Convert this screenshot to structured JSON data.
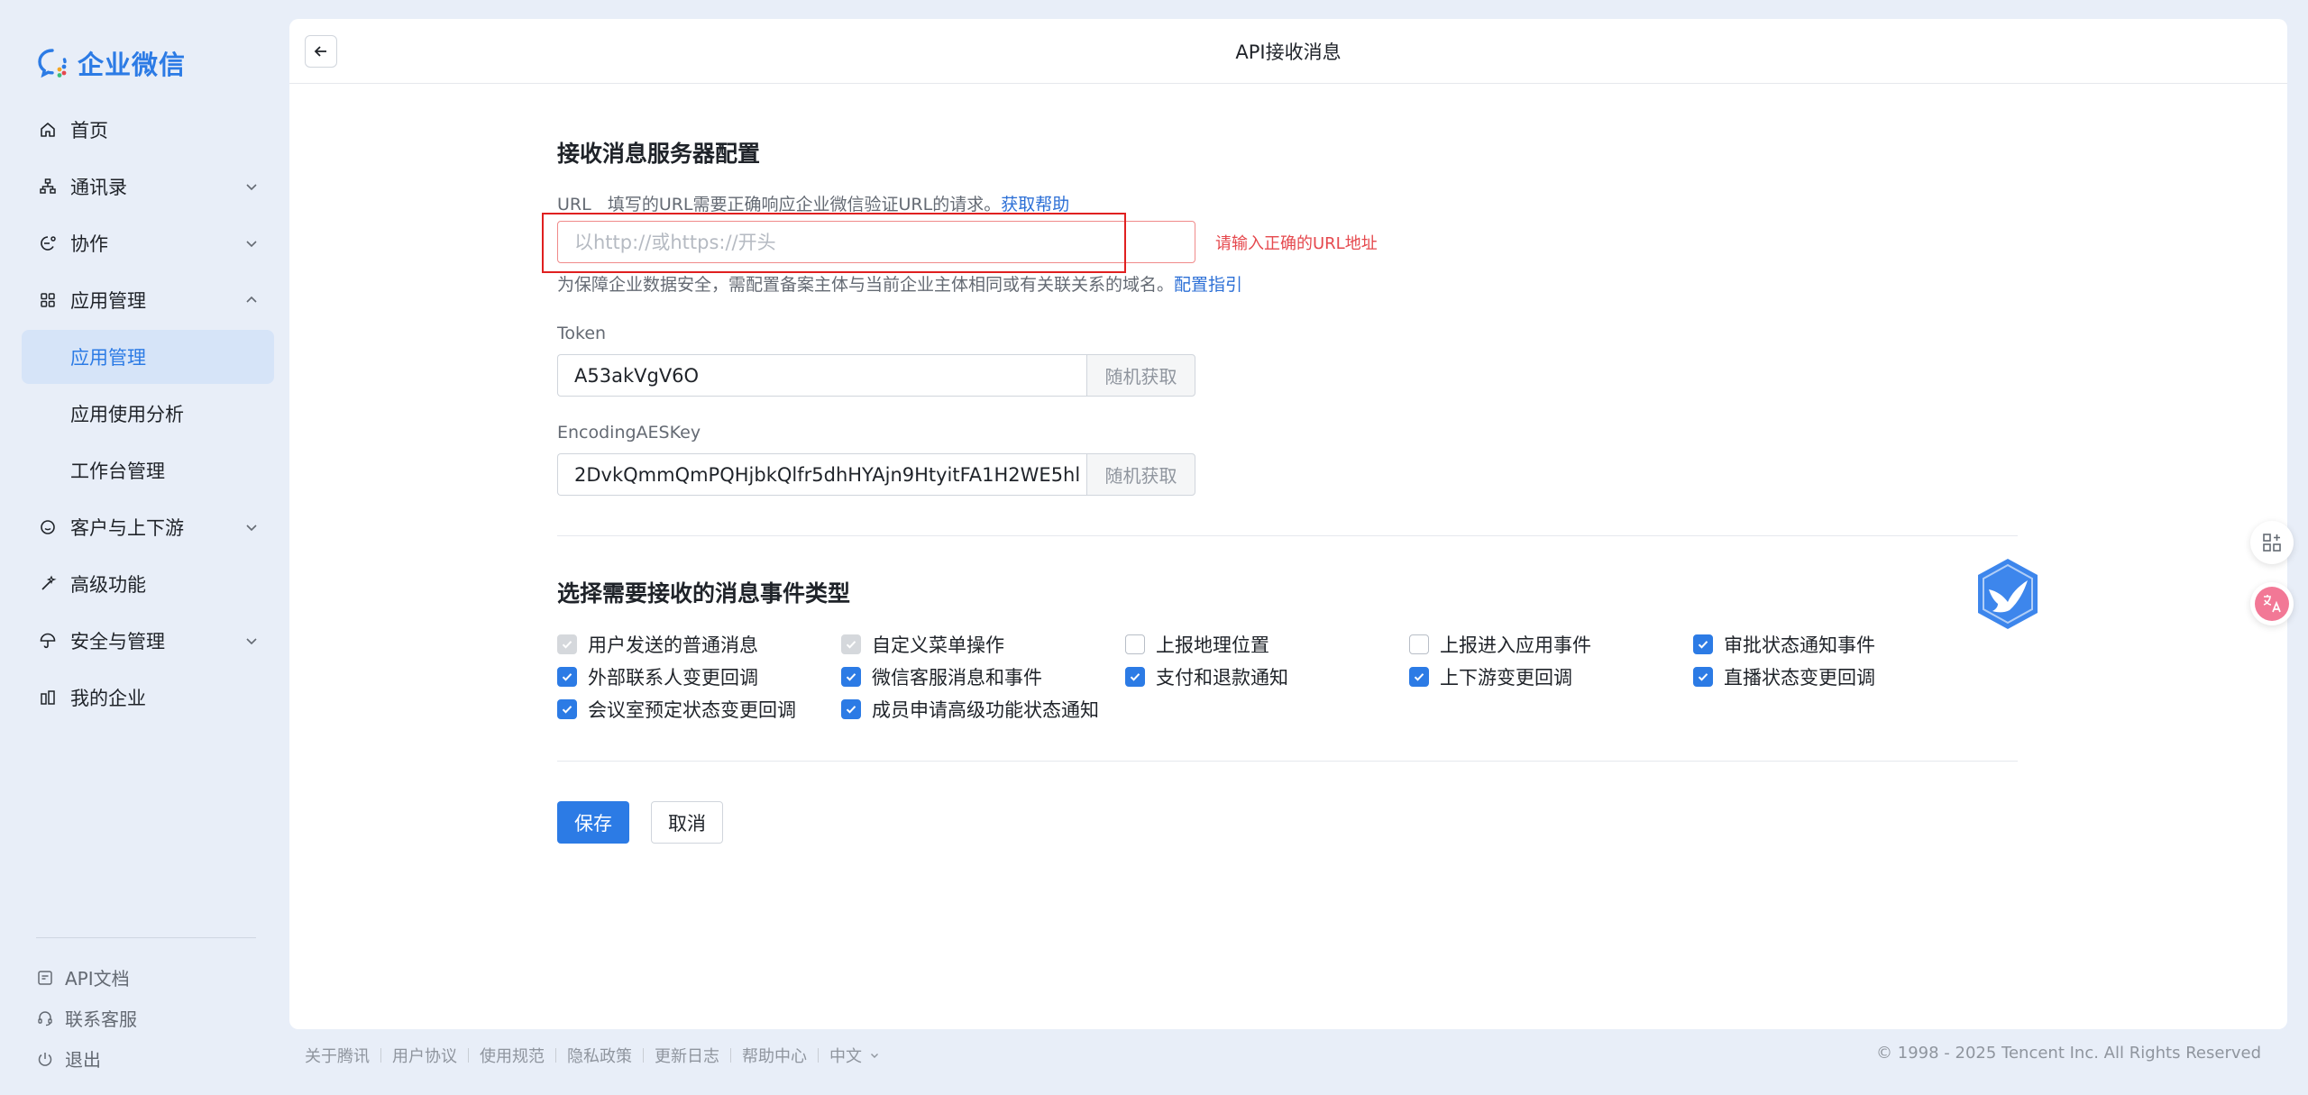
{
  "app": {
    "logo_text": "企业微信"
  },
  "sidebar": {
    "items": [
      {
        "label": "首页"
      },
      {
        "label": "通讯录"
      },
      {
        "label": "协作"
      },
      {
        "label": "应用管理"
      },
      {
        "label": "客户与上下游"
      },
      {
        "label": "高级功能"
      },
      {
        "label": "安全与管理"
      },
      {
        "label": "我的企业"
      }
    ],
    "sub_items": [
      {
        "label": "应用管理",
        "active": true
      },
      {
        "label": "应用使用分析"
      },
      {
        "label": "工作台管理"
      }
    ],
    "bottom": [
      {
        "label": "API文档"
      },
      {
        "label": "联系客服"
      },
      {
        "label": "退出"
      }
    ]
  },
  "header": {
    "title": "API接收消息"
  },
  "server_config": {
    "title": "接收消息服务器配置",
    "url_label": "URL",
    "url_desc": "填写的URL需要正确响应企业微信验证URL的请求。",
    "url_help_link": "获取帮助",
    "url_placeholder": "以http://或https://开头",
    "url_value": "",
    "url_error": "请输入正确的URL地址",
    "domain_hint": "为保障企业数据安全，需配置备案主体与当前企业主体相同或有关联关系的域名。",
    "domain_hint_link": "配置指引",
    "token_label": "Token",
    "token_value": "A53akVgV6O",
    "token_btn": "随机获取",
    "aes_label": "EncodingAESKey",
    "aes_value": "2DvkQmmQmPQHjbkQlfr5dhHYAjn9HtyitFA1H2WE5hl",
    "aes_btn": "随机获取"
  },
  "events": {
    "title": "选择需要接收的消息事件类型",
    "rows": [
      [
        {
          "label": "用户发送的普通消息",
          "state": "disabled"
        },
        {
          "label": "自定义菜单操作",
          "state": "disabled"
        },
        {
          "label": "上报地理位置",
          "state": "unchecked"
        },
        {
          "label": "上报进入应用事件",
          "state": "unchecked"
        },
        {
          "label": "审批状态通知事件",
          "state": "checked"
        }
      ],
      [
        {
          "label": "外部联系人变更回调",
          "state": "checked"
        },
        {
          "label": "微信客服消息和事件",
          "state": "checked"
        },
        {
          "label": "支付和退款通知",
          "state": "checked"
        },
        {
          "label": "上下游变更回调",
          "state": "checked"
        },
        {
          "label": "直播状态变更回调",
          "state": "checked"
        }
      ],
      [
        {
          "label": "会议室预定状态变更回调",
          "state": "checked"
        },
        {
          "label": "成员申请高级功能状态通知",
          "state": "checked"
        }
      ]
    ]
  },
  "actions": {
    "save": "保存",
    "cancel": "取消"
  },
  "footer": {
    "links": [
      "关于腾讯",
      "用户协议",
      "使用规范",
      "隐私政策",
      "更新日志",
      "帮助中心",
      "中文"
    ],
    "copyright": "© 1998 - 2025 Tencent Inc. All Rights Reserved"
  },
  "colors": {
    "accent": "#2c7be5",
    "error": "#e5484d",
    "background": "#e8eef8"
  }
}
